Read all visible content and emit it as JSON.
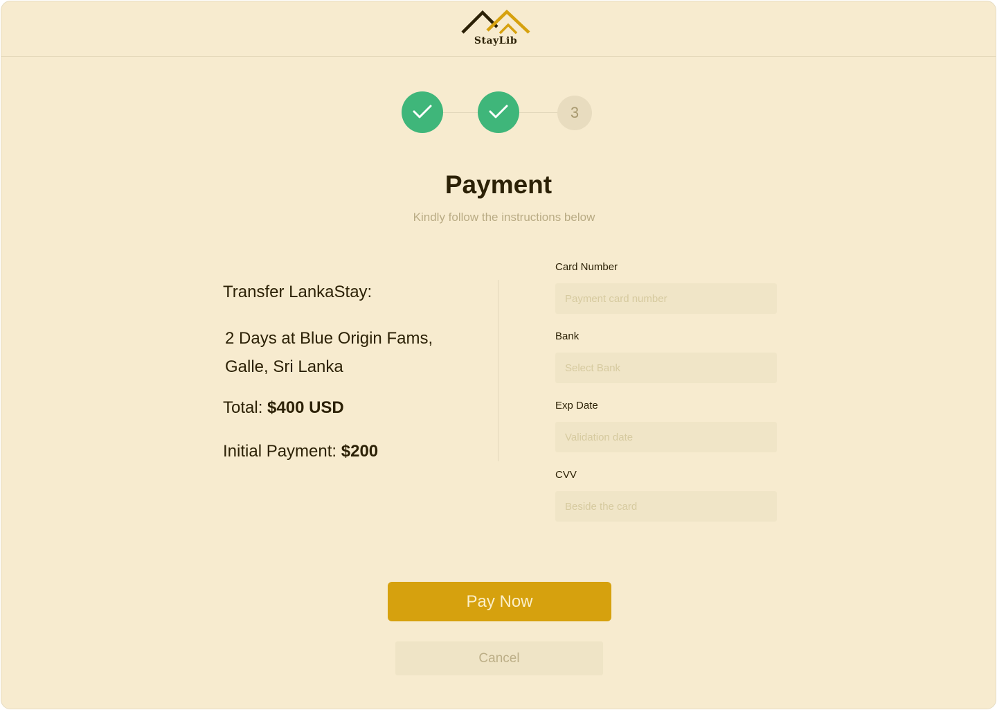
{
  "header": {
    "logo_text": "StayLib"
  },
  "stepper": {
    "steps": [
      {
        "status": "complete",
        "icon": "check-icon"
      },
      {
        "status": "complete",
        "icon": "check-icon"
      },
      {
        "status": "current",
        "label": "3"
      }
    ],
    "complete_color": "#3fb67a"
  },
  "page": {
    "title": "Payment",
    "subtitle": "Kindly follow the instructions below"
  },
  "summary": {
    "transfer_label": "Transfer LankaStay:",
    "trip_line1": "2 Days at Blue Origin Fams,",
    "trip_line2": "Galle, Sri Lanka",
    "total_label": "Total: ",
    "total_value": "$400 USD",
    "initial_label": "Initial Payment: ",
    "initial_value": "$200"
  },
  "form": {
    "card_number": {
      "label": "Card Number",
      "placeholder": "Payment card number",
      "value": ""
    },
    "bank": {
      "label": "Bank",
      "placeholder": "Select Bank",
      "value": ""
    },
    "exp_date": {
      "label": "Exp Date",
      "placeholder": "Validation date",
      "value": ""
    },
    "cvv": {
      "label": "CVV",
      "placeholder": "Beside the card",
      "value": ""
    }
  },
  "actions": {
    "pay_label": "Pay Now",
    "cancel_label": "Cancel",
    "accent_color": "#d6a10e"
  }
}
